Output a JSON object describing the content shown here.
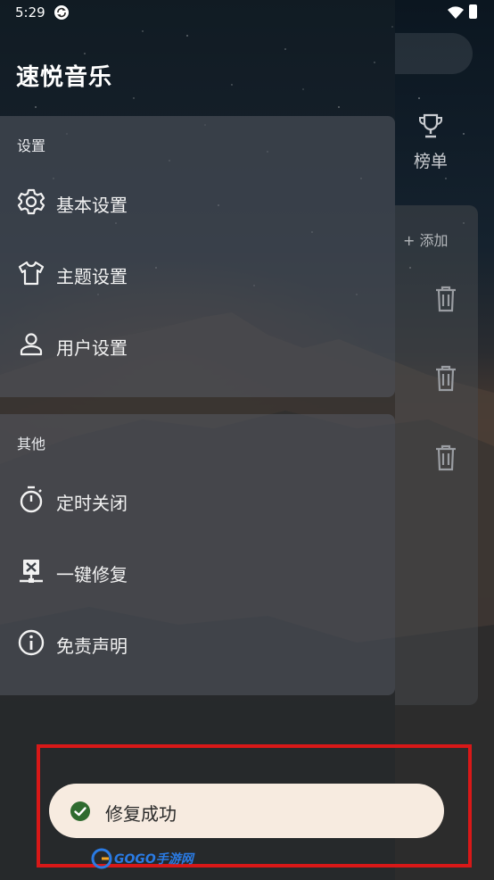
{
  "status_bar": {
    "time": "5:29"
  },
  "app": {
    "title": "速悦音乐"
  },
  "drawer": {
    "section_settings": "设置",
    "settings_items": [
      {
        "label": "基本设置",
        "icon": "gear-icon"
      },
      {
        "label": "主题设置",
        "icon": "shirt-icon"
      },
      {
        "label": "用户设置",
        "icon": "person-icon"
      }
    ],
    "section_other": "其他",
    "other_items": [
      {
        "label": "定时关闭",
        "icon": "stopwatch-icon"
      },
      {
        "label": "一键修复",
        "icon": "repair-icon"
      },
      {
        "label": "免责声明",
        "icon": "info-icon"
      }
    ]
  },
  "background_screen": {
    "rank_label": "榜单",
    "add_label": "+ 添加"
  },
  "toast": {
    "message": "修复成功",
    "icon": "check-circle-icon",
    "icon_color": "#2f6b2f"
  },
  "watermark": {
    "text": "GOGO手游网"
  },
  "colors": {
    "highlight_border": "#d81818",
    "toast_bg": "#f7ebe0"
  }
}
